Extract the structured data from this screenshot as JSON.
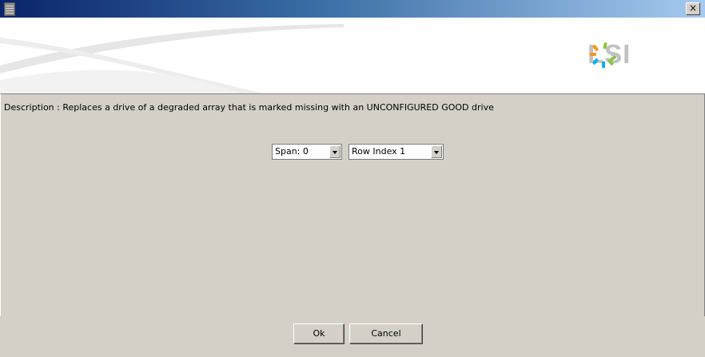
{
  "window": {
    "title": "",
    "app_icon": "server-icon",
    "close_label": "×",
    "titlebar_colors": [
      "#0a246a",
      "#3a6ea5",
      "#a6caf0"
    ]
  },
  "banner": {
    "logo_text": "LSI",
    "logo_icon": "lsi-starburst-icon",
    "logo_colors": [
      "#f7941d",
      "#8dc63f",
      "#00aeef",
      "#c2c2c2"
    ]
  },
  "content": {
    "description": "Description : Replaces a drive of a degraded array that is marked missing with an UNCONFIGURED GOOD drive",
    "span_select": {
      "value": "Span: 0"
    },
    "row_index_select": {
      "value": "Row Index 1"
    }
  },
  "footer": {
    "ok_label": "Ok",
    "cancel_label": "Cancel"
  }
}
